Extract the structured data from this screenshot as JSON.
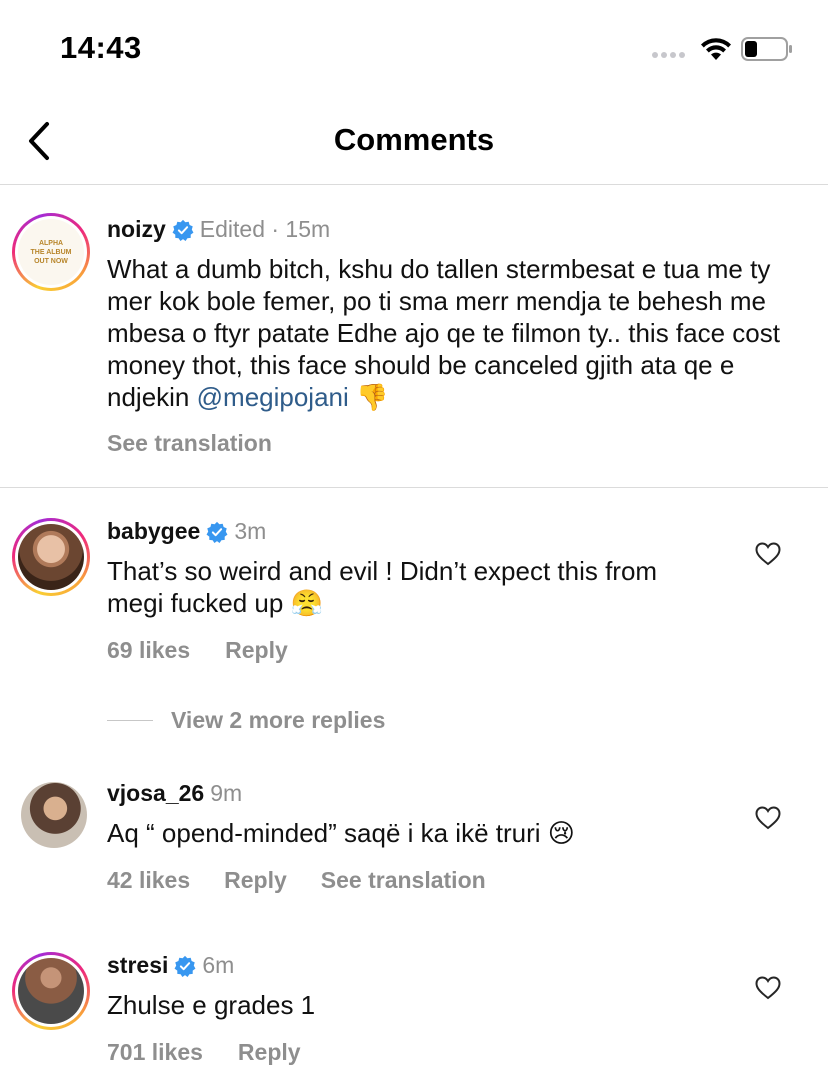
{
  "status_bar": {
    "time": "14:43"
  },
  "header": {
    "title": "Comments"
  },
  "comments": [
    {
      "username": "noizy",
      "meta": "Edited · 15m",
      "avatar_text": [
        "ALPHA",
        "THE ALBUM",
        "OUT NOW"
      ],
      "text": "What a dumb bitch, kshu do tallen stermbesat e tua me ty mer kok bole femer, po ti sma merr mendja te behesh me mbesa o ftyr patate Edhe ajo qe te filmon ty.. this face cost money thot, this face should be canceled gjith ata qe e ndjekin",
      "mention": "@megipojani",
      "emoji": "👎",
      "action_translate": "See translation"
    },
    {
      "username": "babygee",
      "meta": "3m",
      "text": "That’s so weird and evil ! Didn’t expect this from megi fucked up",
      "emoji": "😤",
      "likes": "69 likes",
      "reply": "Reply",
      "view_replies": "View 2 more replies"
    },
    {
      "username": "vjosa_26",
      "meta": "9m",
      "text": "Aq “ opend-minded” saqë i ka ikë truri",
      "emoji": "😢",
      "likes": "42 likes",
      "reply": "Reply",
      "translate": "See translation"
    },
    {
      "username": "stresi",
      "meta": "6m",
      "text": "Zhulse e grades 1",
      "likes": "701 likes",
      "reply": "Reply"
    }
  ],
  "colors": {
    "link": "#2f5c8a",
    "secondary": "#8e8e8e",
    "verified": "#3897f0"
  },
  "icons": [
    "back-chevron-icon",
    "heart-outline-icon",
    "verified-badge-icon",
    "wifi-icon",
    "battery-icon"
  ]
}
